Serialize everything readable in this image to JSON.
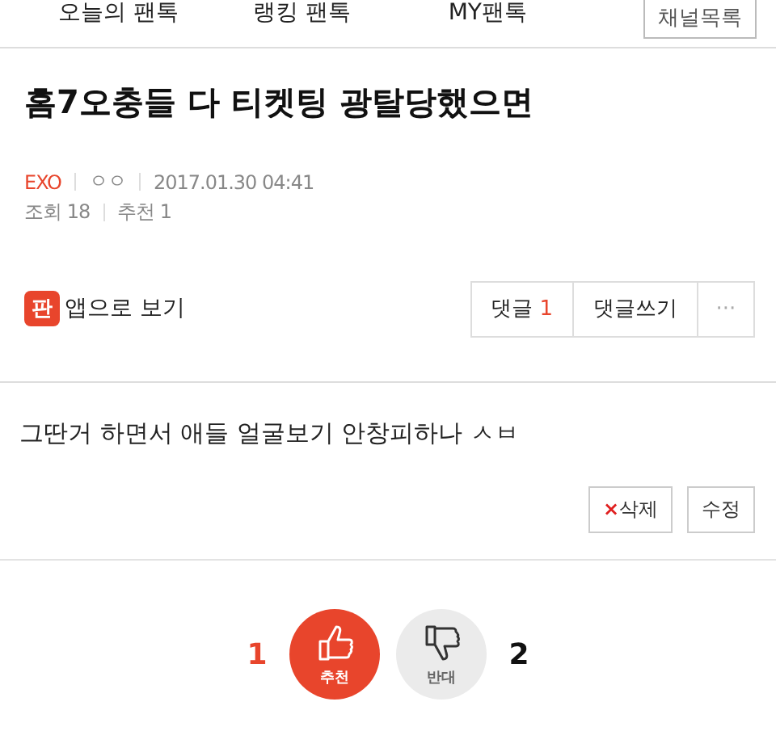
{
  "nav": {
    "tabs": [
      {
        "label": "오늘의 팬톡",
        "selected": false
      },
      {
        "label": "랭킹 팬톡",
        "selected": false
      },
      {
        "label": "MY팬톡",
        "selected": false
      }
    ],
    "channel_button": "채널목록"
  },
  "post": {
    "title": "홈7오충들 다 티켓팅 광탈당했으면",
    "channel": "EXO",
    "author": "ㅇㅇ",
    "date": "2017.01.30 04:41",
    "views": "조회 18",
    "recommends": "추천 1"
  },
  "app_link": {
    "icon_text": "판",
    "label": "앱으로 보기"
  },
  "actions": {
    "comments_label": "댓글",
    "comments_count": "1",
    "write_comment": "댓글쓰기",
    "more": "···"
  },
  "body": "그딴거 하면서 애들 얼굴보기 안창피하나 ㅅㅂ",
  "edit_buttons": [
    {
      "kind": "delete",
      "label": "삭제",
      "icon": "×"
    },
    {
      "kind": "edit",
      "label": "수정"
    }
  ],
  "votes": [
    {
      "kind": "up",
      "label": "추천",
      "count": "1",
      "selected": true
    },
    {
      "kind": "down",
      "label": "반대",
      "count": "2",
      "selected": false
    }
  ]
}
